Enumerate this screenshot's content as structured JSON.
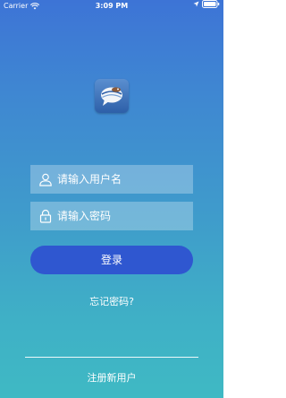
{
  "status_bar": {
    "carrier": "Carrier",
    "time": "3:09 PM",
    "icons": [
      "wifi-icon",
      "location-icon",
      "battery-icon"
    ]
  },
  "logo": {
    "icon": "chat-bubble-logo-icon"
  },
  "login_form": {
    "username_placeholder": "请输入用户名",
    "username_value": "",
    "username_icon": "user-icon",
    "password_placeholder": "请输入密码",
    "password_value": "",
    "password_icon": "lock-icon",
    "login_label": "登录",
    "forgot_label": "忘记密码?"
  },
  "footer": {
    "register_label": "注册新用户"
  },
  "colors": {
    "gradient_top": "#3d74d6",
    "gradient_bottom": "#3fb9c4",
    "button": "#2f57d0",
    "text": "#ffffff"
  }
}
